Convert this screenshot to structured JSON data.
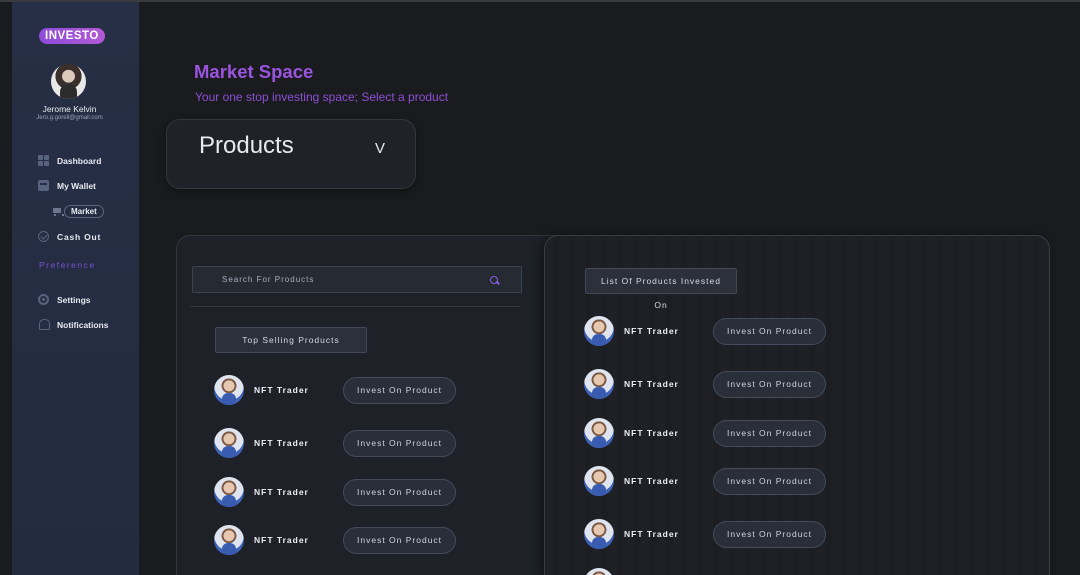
{
  "app": {
    "logo": "INVESTO"
  },
  "user": {
    "name": "Jerome Kelvin",
    "email": "Jero.g.gorell@gmail.com"
  },
  "sidebar": {
    "items": [
      {
        "label": "Dashboard",
        "icon": "grid-icon"
      },
      {
        "label": "My Wallet",
        "icon": "wallet-icon"
      },
      {
        "label": "Market",
        "icon": "cart-icon"
      },
      {
        "label": "Cash Out",
        "icon": "check-circle-icon"
      },
      {
        "label": "Preference",
        "icon": ""
      },
      {
        "label": "Settings",
        "icon": "gear-icon"
      },
      {
        "label": "Notifications",
        "icon": "bell-icon"
      }
    ]
  },
  "header": {
    "title": "Market Space",
    "subtitle": "Your one stop investing space; Select a product"
  },
  "product_select": {
    "value": "Products",
    "chevron": "V"
  },
  "left_panel": {
    "search_placeholder": "Search For Products",
    "section_title": "Top Selling Products",
    "items": [
      {
        "name": "NFT Trader",
        "action": "Invest On Product"
      },
      {
        "name": "NFT Trader",
        "action": "Invest On Product"
      },
      {
        "name": "NFT Trader",
        "action": "Invest On Product"
      },
      {
        "name": "NFT Trader",
        "action": "Invest On Product"
      }
    ]
  },
  "right_panel": {
    "section_title": "List Of Products Invested On",
    "items": [
      {
        "name": "NFT Trader",
        "action": "Invest On Product"
      },
      {
        "name": "NFT Trader",
        "action": "Invest On Product"
      },
      {
        "name": "NFT Trader",
        "action": "Invest On Product"
      },
      {
        "name": "NFT Trader",
        "action": "Invest On Product"
      },
      {
        "name": "NFT Trader",
        "action": "Invest On Product"
      }
    ]
  },
  "colors": {
    "accent": "#9a54e0",
    "sidebar": "#262f45",
    "background": "#1a1b1e"
  }
}
